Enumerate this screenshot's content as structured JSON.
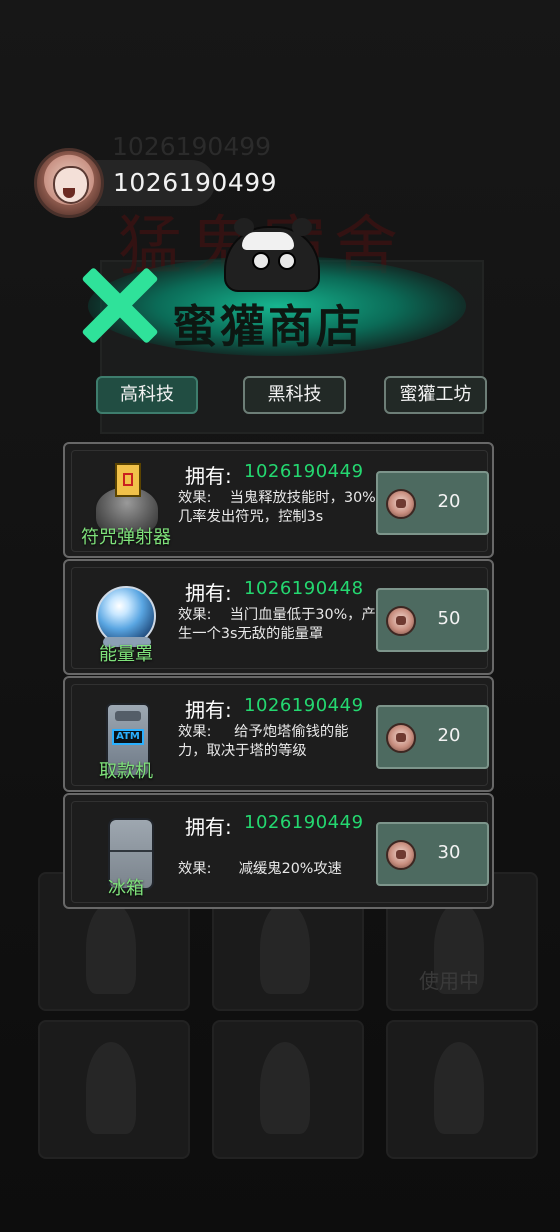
{
  "background": {
    "faint_id": "1026190499",
    "status_label": "使用中"
  },
  "user": {
    "coin_id": "1026190499"
  },
  "shop": {
    "title": "蜜獾商店"
  },
  "tabs": [
    {
      "label": "高科技",
      "active": true
    },
    {
      "label": "黑科技",
      "active": false
    },
    {
      "label": "蜜獾工坊",
      "active": false
    }
  ],
  "items": [
    {
      "name": "符咒弹射器",
      "own_label": "拥有:",
      "own_value": "1026190449",
      "effect_label": "效果:",
      "effect_text": "当鬼释放技能时，30%几率发出符咒，控制3s",
      "price": "20",
      "icon": "talisman-launcher-icon"
    },
    {
      "name": "能量罩",
      "own_label": "拥有:",
      "own_value": "1026190448",
      "effect_label": "效果:",
      "effect_text": "当门血量低于30%，产生一个3s无敌的能量罩",
      "price": "50",
      "icon": "energy-shield-icon"
    },
    {
      "name": "取款机",
      "own_label": "拥有:",
      "own_value": "1026190449",
      "effect_label": "效果:",
      "effect_text": "给予炮塔偷钱的能力，取决于塔的等级",
      "price": "20",
      "icon": "atm-icon"
    },
    {
      "name": "冰箱",
      "own_label": "拥有:",
      "own_value": "1026190449",
      "effect_label": "效果:",
      "effect_text": "减缓鬼20%攻速",
      "price": "30",
      "icon": "fridge-icon"
    }
  ],
  "atm_screen": "ATM",
  "colors": {
    "accent": "#2fe29a",
    "owned_value": "#24d870",
    "price_button": "#4d6a60"
  }
}
